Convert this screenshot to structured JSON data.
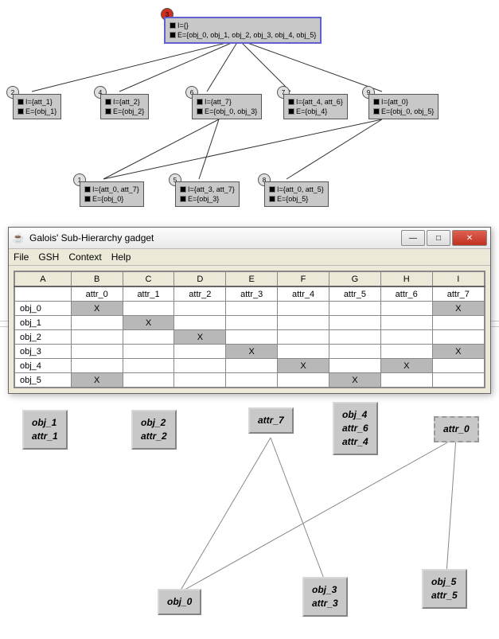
{
  "graph": {
    "root": {
      "num": "3",
      "line1": "I={}",
      "line2": "E={obj_0, obj_1, obj_2, obj_3, obj_4, obj_5}"
    },
    "mid": [
      {
        "num": "2",
        "line1": "I={att_1}",
        "line2": "E={obj_1}"
      },
      {
        "num": "4",
        "line1": "I={att_2}",
        "line2": "E={obj_2}"
      },
      {
        "num": "6",
        "line1": "I={att_7}",
        "line2": "E={obj_0, obj_3}"
      },
      {
        "num": "7",
        "line1": "I={att_4, att_6}",
        "line2": "E={obj_4}"
      },
      {
        "num": "9",
        "line1": "I={att_0}",
        "line2": "E={obj_0, obj_5}"
      }
    ],
    "bot": [
      {
        "num": "1",
        "line1": "I={att_0, att_7}",
        "line2": "E={obj_0}"
      },
      {
        "num": "5",
        "line1": "I={att_3, att_7}",
        "line2": "E={obj_3}"
      },
      {
        "num": "8",
        "line1": "I={att_0, att_5}",
        "line2": "E={obj_5}"
      }
    ]
  },
  "window": {
    "title": "Galois' Sub-Hierarchy gadget",
    "menu": {
      "file": "File",
      "gsh": "GSH",
      "context": "Context",
      "help": "Help"
    },
    "cols_letters": [
      "A",
      "B",
      "C",
      "D",
      "E",
      "F",
      "G",
      "H",
      "I"
    ],
    "cols_attrs": [
      "",
      "attr_0",
      "attr_1",
      "attr_2",
      "attr_3",
      "attr_4",
      "attr_5",
      "attr_6",
      "attr_7"
    ],
    "rows": [
      {
        "h": "obj_0",
        "marks": [
          1,
          0,
          0,
          0,
          0,
          0,
          0,
          1
        ]
      },
      {
        "h": "obj_1",
        "marks": [
          0,
          1,
          0,
          0,
          0,
          0,
          0,
          0
        ]
      },
      {
        "h": "obj_2",
        "marks": [
          0,
          0,
          1,
          0,
          0,
          0,
          0,
          0
        ]
      },
      {
        "h": "obj_3",
        "marks": [
          0,
          0,
          0,
          1,
          0,
          0,
          0,
          1
        ]
      },
      {
        "h": "obj_4",
        "marks": [
          0,
          0,
          0,
          0,
          1,
          0,
          1,
          0
        ]
      },
      {
        "h": "obj_5",
        "marks": [
          1,
          0,
          0,
          0,
          0,
          1,
          0,
          0
        ]
      }
    ],
    "mark_sym": "X"
  },
  "lower": {
    "n_obj1": {
      "l1": "obj_1",
      "l2": "attr_1"
    },
    "n_obj2": {
      "l1": "obj_2",
      "l2": "attr_2"
    },
    "n_attr7": {
      "l1": "attr_7",
      "l2": ""
    },
    "n_obj4": {
      "l1": "obj_4",
      "l2": "attr_6",
      "l3": "attr_4"
    },
    "n_attr0": {
      "l1": "attr_0",
      "l2": ""
    },
    "n_obj0": {
      "l1": "obj_0",
      "l2": ""
    },
    "n_obj3": {
      "l1": "obj_3",
      "l2": "attr_3"
    },
    "n_obj5": {
      "l1": "obj_5",
      "l2": "attr_5"
    }
  }
}
